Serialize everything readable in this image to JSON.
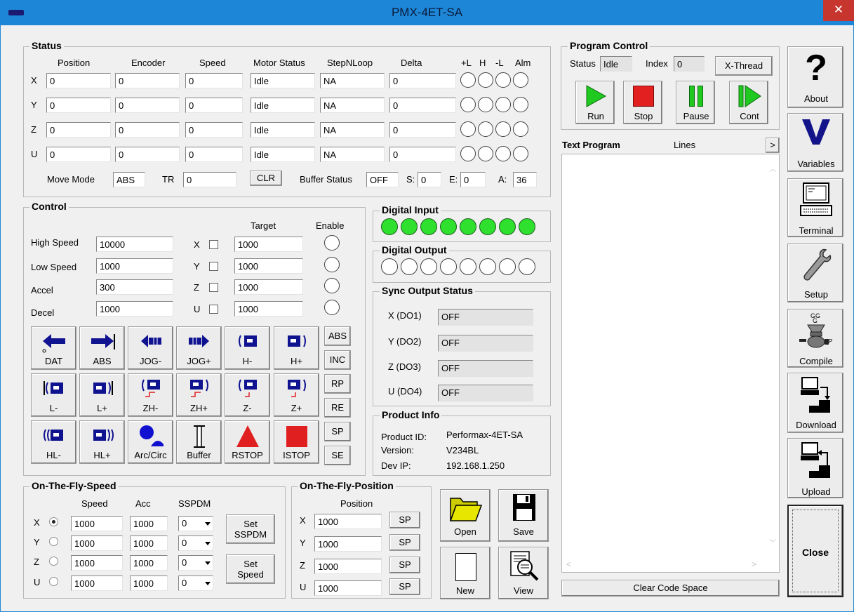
{
  "window": {
    "title": "PMX-4ET-SA",
    "close_glyph": "✕",
    "icon": "app-icon"
  },
  "status": {
    "legend": "Status",
    "columns": [
      "Position",
      "Encoder",
      "Speed",
      "Motor Status",
      "StepNLoop",
      "Delta"
    ],
    "flag_headers": [
      "+L",
      "H",
      "-L",
      "Alm"
    ],
    "rows": [
      {
        "axis": "X",
        "position": "0",
        "encoder": "0",
        "speed": "0",
        "motor_status": "Idle",
        "stepnloop": "NA",
        "delta": "0"
      },
      {
        "axis": "Y",
        "position": "0",
        "encoder": "0",
        "speed": "0",
        "motor_status": "Idle",
        "stepnloop": "NA",
        "delta": "0"
      },
      {
        "axis": "Z",
        "position": "0",
        "encoder": "0",
        "speed": "0",
        "motor_status": "Idle",
        "stepnloop": "NA",
        "delta": "0"
      },
      {
        "axis": "U",
        "position": "0",
        "encoder": "0",
        "speed": "0",
        "motor_status": "Idle",
        "stepnloop": "NA",
        "delta": "0"
      }
    ],
    "move_mode_label": "Move Mode",
    "move_mode": "ABS",
    "tr_label": "TR",
    "tr": "0",
    "clr_label": "CLR",
    "buffer_status_label": "Buffer Status",
    "buffer_status": "OFF",
    "s_label": "S:",
    "s": "0",
    "e_label": "E:",
    "e": "0",
    "a_label": "A:",
    "a": "36"
  },
  "program_control": {
    "legend": "Program Control",
    "status_label": "Status",
    "status": "Idle",
    "index_label": "Index",
    "index": "0",
    "xthread_label": "X-Thread",
    "run_label": "Run",
    "stop_label": "Stop",
    "pause_label": "Pause",
    "cont_label": "Cont"
  },
  "text_program": {
    "title": "Text Program",
    "lines_label": "Lines",
    "scroll_right": ">",
    "clear_label": "Clear Code Space"
  },
  "control": {
    "legend": "Control",
    "target_header": "Target",
    "enable_header": "Enable",
    "high_speed_label": "High Speed",
    "high_speed": "10000",
    "low_speed_label": "Low Speed",
    "low_speed": "1000",
    "accel_label": "Accel",
    "accel": "300",
    "decel_label": "Decel",
    "decel": "1000",
    "targets": [
      {
        "axis": "X",
        "value": "1000"
      },
      {
        "axis": "Y",
        "value": "1000"
      },
      {
        "axis": "Z",
        "value": "1000"
      },
      {
        "axis": "U",
        "value": "1000"
      }
    ],
    "buttons": [
      "DAT",
      "ABS",
      "JOG-",
      "JOG+",
      "H-",
      "H+",
      "L-",
      "L+",
      "ZH-",
      "ZH+",
      "Z-",
      "Z+",
      "HL-",
      "HL+",
      "Arc/Circ",
      "Buffer",
      "RSTOP",
      "ISTOP"
    ],
    "side_buttons": [
      "ABS",
      "INC",
      "RP",
      "RE",
      "SP",
      "SE"
    ]
  },
  "digital_input": {
    "legend": "Digital Input",
    "states": [
      true,
      true,
      true,
      true,
      true,
      true,
      true,
      true
    ]
  },
  "digital_output": {
    "legend": "Digital Output",
    "states": [
      false,
      false,
      false,
      false,
      false,
      false,
      false,
      false
    ]
  },
  "sync_output": {
    "legend": "Sync Output Status",
    "rows": [
      {
        "label": "X (DO1)",
        "value": "OFF"
      },
      {
        "label": "Y (DO2)",
        "value": "OFF"
      },
      {
        "label": "Z (DO3)",
        "value": "OFF"
      },
      {
        "label": "U (DO4)",
        "value": "OFF"
      }
    ]
  },
  "product_info": {
    "legend": "Product Info",
    "product_id_label": "Product ID:",
    "product_id": "Performax-4ET-SA",
    "version_label": "Version:",
    "version": "V234BL",
    "dev_ip_label": "Dev IP:",
    "dev_ip": "192.168.1.250"
  },
  "otf_speed": {
    "legend": "On-The-Fly-Speed",
    "speed_header": "Speed",
    "acc_header": "Acc",
    "sspdm_header": "SSPDM",
    "rows": [
      {
        "axis": "X",
        "speed": "1000",
        "acc": "1000",
        "sspdm": "0",
        "selected": true
      },
      {
        "axis": "Y",
        "speed": "1000",
        "acc": "1000",
        "sspdm": "0",
        "selected": false
      },
      {
        "axis": "Z",
        "speed": "1000",
        "acc": "1000",
        "sspdm": "0",
        "selected": false
      },
      {
        "axis": "U",
        "speed": "1000",
        "acc": "1000",
        "sspdm": "0",
        "selected": false
      }
    ],
    "set_sspdm_label": [
      "Set",
      "SSPDM"
    ],
    "set_speed_label": [
      "Set",
      "Speed"
    ]
  },
  "otf_position": {
    "legend": "On-The-Fly-Position",
    "position_header": "Position",
    "sp_label": "SP",
    "rows": [
      {
        "axis": "X",
        "value": "1000"
      },
      {
        "axis": "Y",
        "value": "1000"
      },
      {
        "axis": "Z",
        "value": "1000"
      },
      {
        "axis": "U",
        "value": "1000"
      }
    ]
  },
  "file": {
    "open_label": "Open",
    "save_label": "Save",
    "new_label": "New",
    "view_label": "View"
  },
  "sidebar": {
    "about_label": "About",
    "variables_label": "Variables",
    "terminal_label": "Terminal",
    "setup_label": "Setup",
    "compile_label": "Compile",
    "download_label": "Download",
    "upload_label": "Upload",
    "close_label": "Close"
  },
  "colors": {
    "titlebar": "#1e86d6",
    "close": "#c6362e",
    "run": "#1fc91f",
    "stop": "#e32020",
    "led_on": "#2fe02f"
  }
}
